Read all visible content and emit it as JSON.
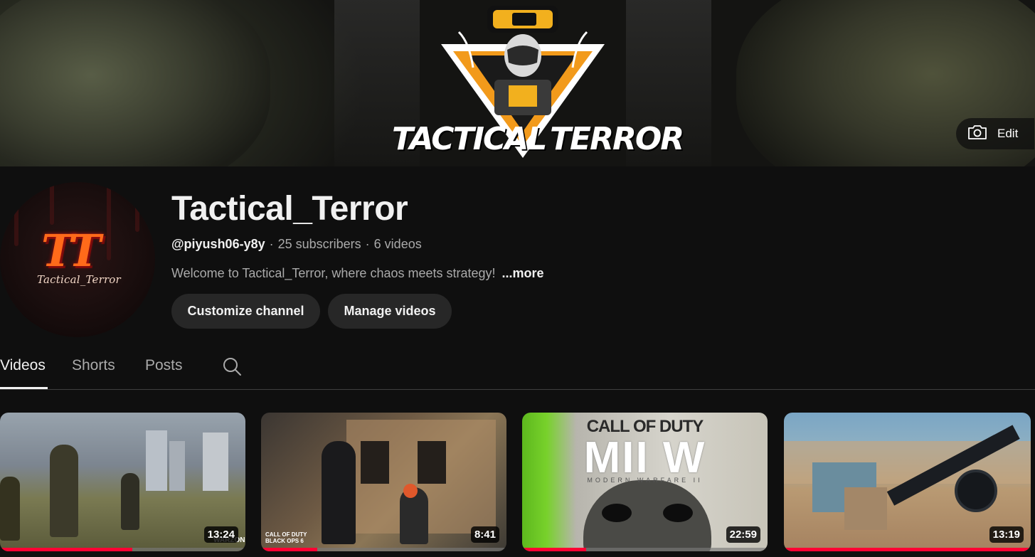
{
  "banner": {
    "title_left": "TACTICAL",
    "title_right": "TERROR",
    "edit_label": "Edit",
    "edit_icon": "camera-icon"
  },
  "channel": {
    "name": "Tactical_Terror",
    "handle": "@piyush06-y8y",
    "subscribers": "25 subscribers",
    "videos_count": "6 videos",
    "separator": "·",
    "description": "Welcome to Tactical_Terror, where chaos meets strategy!",
    "more_label": "...more",
    "avatar_mark": "TT",
    "avatar_sub": "Tactical_Terror"
  },
  "actions": {
    "customize": "Customize channel",
    "manage": "Manage videos"
  },
  "tabs": [
    {
      "label": "Videos",
      "active": true
    },
    {
      "label": "Shorts",
      "active": false
    },
    {
      "label": "Posts",
      "active": false
    }
  ],
  "search_icon": "search-icon",
  "videos": [
    {
      "duration": "13:24",
      "watched_fraction": 0.54,
      "watermark": "WARZONE"
    },
    {
      "duration": "8:41",
      "watched_fraction": 0.23,
      "watermark": "CALL OF DUTY BLACK OPS 6"
    },
    {
      "duration": "22:59",
      "watched_fraction": 0.26,
      "title_text": "CALL OF DUTY",
      "logo_text": "MII W",
      "sub_text": "MODERN WARFARE II"
    },
    {
      "duration": "13:19",
      "watched_fraction": 1.0
    }
  ],
  "colors": {
    "background": "#0f0f0f",
    "button": "#272727",
    "progress": "#ff0033",
    "text_secondary": "#aaaaaa"
  }
}
